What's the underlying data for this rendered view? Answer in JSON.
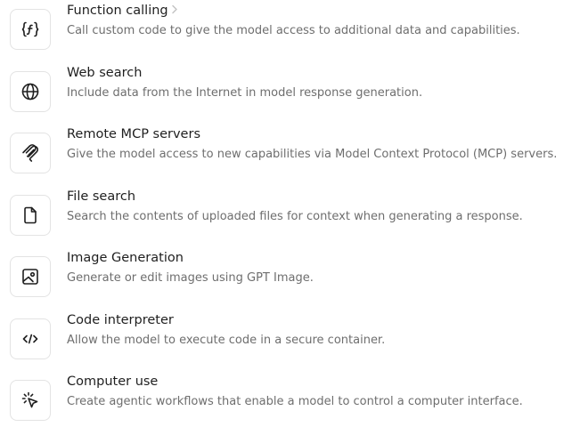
{
  "tools": [
    {
      "icon": "function-icon",
      "title": "Function calling",
      "description": "Call custom code to give the model access to additional data and capabilities."
    },
    {
      "icon": "globe-icon",
      "title": "Web search",
      "description": "Include data from the Internet in model response generation."
    },
    {
      "icon": "mcp-icon",
      "title": "Remote MCP servers",
      "description": "Give the model access to new capabilities via Model Context Protocol (MCP) servers."
    },
    {
      "icon": "file-icon",
      "title": "File search",
      "description": "Search the contents of uploaded files for context when generating a response."
    },
    {
      "icon": "image-icon",
      "title": "Image Generation",
      "description": "Generate or edit images using GPT Image."
    },
    {
      "icon": "code-icon",
      "title": "Code interpreter",
      "description": "Allow the model to execute code in a secure container."
    },
    {
      "icon": "cursor-click-icon",
      "title": "Computer use",
      "description": "Create agentic workflows that enable a model to control a computer interface."
    }
  ],
  "colors": {
    "title": "#1f1f1f",
    "description": "#6e6e6e",
    "icon_border": "#e3e3e3",
    "icon_stroke": "#1f1f1f",
    "chevron": "#c4c4c4"
  }
}
